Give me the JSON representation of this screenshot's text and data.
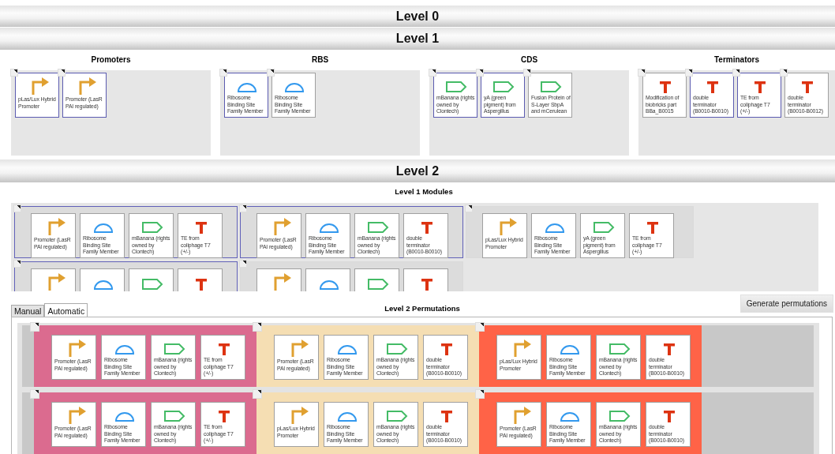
{
  "level_0": {
    "title": "Level 0"
  },
  "level_1": {
    "title": "Level 1",
    "categories": [
      {
        "title": "Promoters",
        "parts": [
          {
            "kind": "promoter",
            "label": "pLas/Lux Hybrid Promoter",
            "selected": true
          },
          {
            "kind": "promoter",
            "label": "Promoter (LasR PAI regulated)",
            "selected": true
          }
        ]
      },
      {
        "title": "RBS",
        "parts": [
          {
            "kind": "rbs",
            "label": "Ribosome Binding Site Family Member",
            "selected": true
          },
          {
            "kind": "rbs",
            "label": "Ribosome Binding Site Family Member",
            "selected": false
          }
        ]
      },
      {
        "title": "CDS",
        "parts": [
          {
            "kind": "cds",
            "label": "mBanana (rights owned by Clontech)",
            "selected": true
          },
          {
            "kind": "cds",
            "label": "yA (green pigment) from Aspergillus",
            "selected": true
          },
          {
            "kind": "cds",
            "label": "Fusion Protein of S-Layer SbpA and mCerulean",
            "selected": false
          }
        ]
      },
      {
        "title": "Terminators",
        "parts": [
          {
            "kind": "terminator",
            "label": "Modification of biobricks part BBa_B0015",
            "selected": false
          },
          {
            "kind": "terminator",
            "label": "double terminator (B0010-B0010)",
            "selected": true
          },
          {
            "kind": "terminator",
            "label": "TE from coliphage T7 (+/-)",
            "selected": true
          },
          {
            "kind": "terminator",
            "label": "double terminator (B0010-B0012)",
            "selected": false
          }
        ]
      }
    ]
  },
  "level_2": {
    "title": "Level 2",
    "modules_title": "Level 1 Modules",
    "modules": [
      {
        "selected": true,
        "parts": [
          {
            "kind": "promoter",
            "label": "Promoter (LasR PAI regulated)"
          },
          {
            "kind": "rbs",
            "label": "Ribosome Binding Site Family Member"
          },
          {
            "kind": "cds",
            "label": "mBanana (rights owned by Clontech)"
          },
          {
            "kind": "terminator",
            "label": "TE from coliphage T7 (+/-)"
          }
        ]
      },
      {
        "selected": true,
        "parts": [
          {
            "kind": "promoter",
            "label": "Promoter (LasR PAI regulated)"
          },
          {
            "kind": "rbs",
            "label": "Ribosome Binding Site Family Member"
          },
          {
            "kind": "cds",
            "label": "mBanana (rights owned by Clontech)"
          },
          {
            "kind": "terminator",
            "label": "double terminator (B0010-B0010)"
          }
        ]
      },
      {
        "selected": false,
        "parts": [
          {
            "kind": "promoter",
            "label": "pLas/Lux Hybrid Promoter"
          },
          {
            "kind": "rbs",
            "label": "Ribosome Binding Site Family Member"
          },
          {
            "kind": "cds",
            "label": "yA (green pigment) from Aspergillus"
          },
          {
            "kind": "terminator",
            "label": "TE from coliphage T7 (+/-)"
          }
        ]
      },
      {
        "selected": true,
        "parts": [
          {
            "kind": "promoter"
          },
          {
            "kind": "rbs"
          },
          {
            "kind": "cds"
          },
          {
            "kind": "terminator"
          }
        ]
      },
      {
        "selected": false,
        "parts": [
          {
            "kind": "promoter"
          },
          {
            "kind": "rbs"
          },
          {
            "kind": "cds"
          },
          {
            "kind": "terminator"
          }
        ]
      }
    ],
    "permutations": {
      "title": "Level 2 Permutations",
      "tabs": [
        {
          "label": "Manual",
          "selected": false
        },
        {
          "label": "Automatic",
          "selected": true
        }
      ],
      "button": "Generate permutations",
      "rows": [
        {
          "segments": [
            {
              "color": "#db6b8f",
              "parts": [
                {
                  "kind": "promoter",
                  "label": "Promoter (LasR PAI regulated)"
                },
                {
                  "kind": "rbs",
                  "label": "Ribosome Binding Site Family Member"
                },
                {
                  "kind": "cds",
                  "label": "mBanana (rights owned by Clontech)"
                },
                {
                  "kind": "terminator",
                  "label": "TE from coliphage T7 (+/-)"
                }
              ]
            },
            {
              "color": "#f5deb3",
              "parts": [
                {
                  "kind": "promoter",
                  "label": "Promoter (LasR PAI regulated)"
                },
                {
                  "kind": "rbs",
                  "label": "Ribosome Binding Site Family Member"
                },
                {
                  "kind": "cds",
                  "label": "mBanana (rights owned by Clontech)"
                },
                {
                  "kind": "terminator",
                  "label": "double terminator (B0010-B0010)"
                }
              ]
            },
            {
              "color": "#ff6347",
              "parts": [
                {
                  "kind": "promoter",
                  "label": "pLas/Lux Hybrid Promoter"
                },
                {
                  "kind": "rbs",
                  "label": "Ribosome Binding Site Family Member"
                },
                {
                  "kind": "cds",
                  "label": "mBanana (rights owned by Clontech)"
                },
                {
                  "kind": "terminator",
                  "label": "double terminator (B0010-B0010)"
                }
              ]
            }
          ]
        },
        {
          "segments": [
            {
              "color": "#db6b8f",
              "parts": [
                {
                  "kind": "promoter",
                  "label": "Promoter (LasR PAI regulated)"
                },
                {
                  "kind": "rbs",
                  "label": "Ribosome Binding Site Family Member"
                },
                {
                  "kind": "cds",
                  "label": "mBanana (rights owned by Clontech)"
                },
                {
                  "kind": "terminator",
                  "label": "TE from coliphage T7 (+/-)"
                }
              ]
            },
            {
              "color": "#f5deb3",
              "parts": [
                {
                  "kind": "promoter",
                  "label": "pLas/Lux Hybrid Promoter"
                },
                {
                  "kind": "rbs",
                  "label": "Ribosome Binding Site Family Member"
                },
                {
                  "kind": "cds",
                  "label": "mBanana (rights owned by Clontech)"
                },
                {
                  "kind": "terminator",
                  "label": "double terminator (B0010-B0010)"
                }
              ]
            },
            {
              "color": "#ff6347",
              "parts": [
                {
                  "kind": "promoter",
                  "label": "Promoter (LasR PAI regulated)"
                },
                {
                  "kind": "rbs",
                  "label": "Ribosome Binding Site Family Member"
                },
                {
                  "kind": "cds",
                  "label": "mBanana (rights owned by Clontech)"
                },
                {
                  "kind": "terminator",
                  "label": "double terminator (B0010-B0010)"
                }
              ]
            }
          ]
        }
      ]
    }
  }
}
